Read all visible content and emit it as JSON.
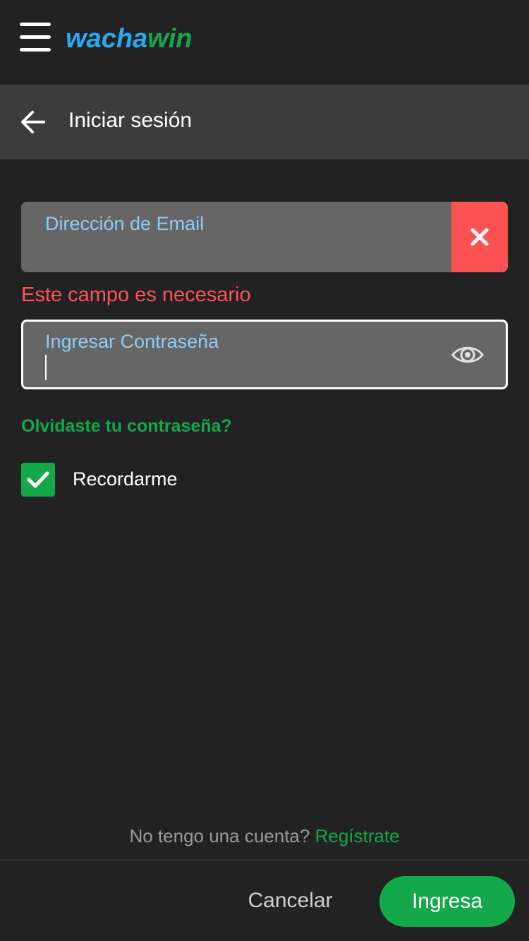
{
  "header": {
    "menu_icon": "hamburger-menu-icon",
    "logo_part1": "wacha",
    "logo_part2": "win",
    "colors": {
      "logo_blue": "#2aa8f2",
      "logo_green": "#13a84a"
    }
  },
  "titlebar": {
    "back_icon": "arrow-left-icon",
    "title": "Iniciar sesión"
  },
  "form": {
    "email": {
      "label": "Dirección de Email",
      "value": "",
      "clear_icon": "close-icon"
    },
    "email_error": "Este campo es necesario",
    "password": {
      "label": "Ingresar Contraseña",
      "value": "",
      "toggle_icon": "eye-icon"
    },
    "forgot_link": "Olvidaste tu contraseña?",
    "remember": {
      "label": "Recordarme",
      "checked": true,
      "icon": "checkmark-icon"
    }
  },
  "signup": {
    "question": "No tengo una cuenta?",
    "link": "Regístrate"
  },
  "footer": {
    "cancel_label": "Cancelar",
    "submit_label": "Ingresa"
  },
  "colors": {
    "background": "#222222",
    "accent_green": "#13a84a",
    "error_red": "#ff5252",
    "field_bg": "#666666",
    "label_blue": "#8ecdf2"
  }
}
